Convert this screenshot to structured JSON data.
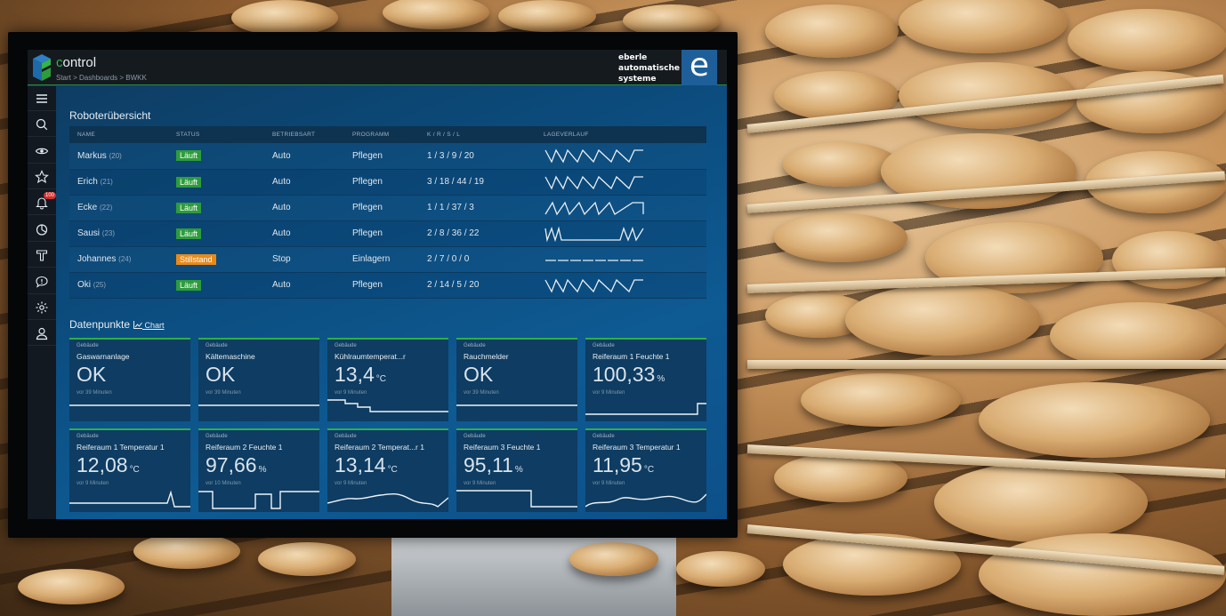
{
  "header": {
    "app_title_prefix": "c",
    "app_title_rest": "ontrol",
    "breadcrumb": "Start  >  Dashboards  >  BWKK",
    "brand_lines": [
      "eberle",
      "automatische",
      "systeme"
    ],
    "brand_mark": "e"
  },
  "sidebar": {
    "items": [
      {
        "icon": "menu-icon"
      },
      {
        "icon": "search-icon"
      },
      {
        "icon": "eye-icon"
      },
      {
        "icon": "star-icon"
      },
      {
        "icon": "bell-icon",
        "badge": "100"
      },
      {
        "icon": "pie-chart-icon"
      },
      {
        "icon": "tool-icon"
      },
      {
        "icon": "message-icon"
      },
      {
        "icon": "gear-icon"
      },
      {
        "icon": "user-icon"
      }
    ]
  },
  "robots": {
    "title": "Roboterübersicht",
    "columns": [
      "NAME",
      "STATUS",
      "BETRIEBSART",
      "PROGRAMM",
      "K / R / S / L",
      "LAGEVERLAUF"
    ],
    "rows": [
      {
        "name": "Markus",
        "id": "(20)",
        "status": "Läuft",
        "status_type": "run",
        "mode": "Auto",
        "program": "Pflegen",
        "krsl": "1  /  3  /  9  / 20",
        "trend": "zigzag"
      },
      {
        "name": "Erich",
        "id": "(21)",
        "status": "Läuft",
        "status_type": "run",
        "mode": "Auto",
        "program": "Pflegen",
        "krsl": "3  / 18 / 44 / 19",
        "trend": "zigzag"
      },
      {
        "name": "Ecke",
        "id": "(22)",
        "status": "Läuft",
        "status_type": "run",
        "mode": "Auto",
        "program": "Pflegen",
        "krsl": "1  /  1  / 37 /  3",
        "trend": "zigzag2"
      },
      {
        "name": "Sausi",
        "id": "(23)",
        "status": "Läuft",
        "status_type": "run",
        "mode": "Auto",
        "program": "Pflegen",
        "krsl": "2  /  8  / 36 / 22",
        "trend": "gap"
      },
      {
        "name": "Johannes",
        "id": "(24)",
        "status": "Stillstand",
        "status_type": "stop",
        "mode": "Stop",
        "program": "Einlagern",
        "krsl": "2  /  7  /  0  /  0",
        "trend": "flat"
      },
      {
        "name": "Oki",
        "id": "(25)",
        "status": "Läuft",
        "status_type": "run",
        "mode": "Auto",
        "program": "Pflegen",
        "krsl": "2  / 14 /  5  / 20",
        "trend": "zigzag"
      }
    ]
  },
  "datapoints": {
    "title": "Datenpunkte",
    "chart_link": "Chart",
    "tiles": [
      {
        "group": "Gebäude",
        "name": "Gaswarnanlage",
        "value": "OK",
        "unit": "",
        "time": "vor 39 Minuten",
        "spark": "flat"
      },
      {
        "group": "Gebäude",
        "name": "Kältemaschine",
        "value": "OK",
        "unit": "",
        "time": "vor 39 Minuten",
        "spark": "flat"
      },
      {
        "group": "Gebäude",
        "name": "Kühlraumtemperat...r",
        "value": "13,4",
        "unit": "°C",
        "time": "vor 9 Minuten",
        "spark": "step-down"
      },
      {
        "group": "Gebäude",
        "name": "Rauchmelder",
        "value": "OK",
        "unit": "",
        "time": "vor 39 Minuten",
        "spark": "flat"
      },
      {
        "group": "Gebäude",
        "name": "Reiferaum 1 Feuchte 1",
        "value": "100,33",
        "unit": "%",
        "time": "vor 9 Minuten",
        "spark": "step-up"
      },
      {
        "group": "Gebäude",
        "name": "Reiferaum 1 Temperatur 1",
        "value": "12,08",
        "unit": "°C",
        "time": "vor 9 Minuten",
        "spark": "spike"
      },
      {
        "group": "Gebäude",
        "name": "Reiferaum 2 Feuchte 1",
        "value": "97,66",
        "unit": "%",
        "time": "vor 10 Minuten",
        "spark": "pulses"
      },
      {
        "group": "Gebäude",
        "name": "Reiferaum 2 Temperat...r 1",
        "value": "13,14",
        "unit": "°C",
        "time": "vor 9 Minuten",
        "spark": "wavy"
      },
      {
        "group": "Gebäude",
        "name": "Reiferaum 3 Feuchte 1",
        "value": "95,11",
        "unit": "%",
        "time": "vor 9 Minuten",
        "spark": "step-down2"
      },
      {
        "group": "Gebäude",
        "name": "Reiferaum 3 Temperatur 1",
        "value": "11,95",
        "unit": "°C",
        "time": "vor 9 Minuten",
        "spark": "wavy2"
      }
    ]
  },
  "colors": {
    "accent_green": "#2fae4a",
    "status_run": "#2e9c3c",
    "status_stop": "#e88a1a",
    "screen_blue": "#0b4a7a"
  }
}
